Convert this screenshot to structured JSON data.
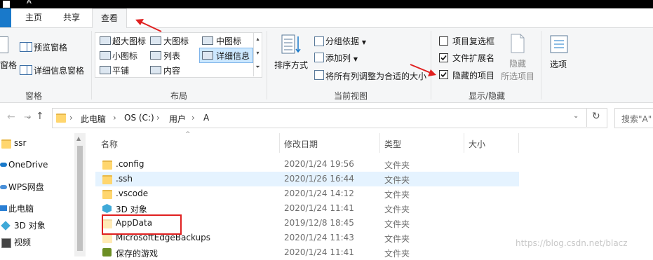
{
  "window": {
    "title": "A"
  },
  "ribbon_tabs": [
    {
      "label": "主页"
    },
    {
      "label": "共享"
    },
    {
      "label": "查看",
      "active": true
    }
  ],
  "ribbon": {
    "panes_group": {
      "nav_pane_partial": "窗格",
      "preview_pane": "预览窗格",
      "details_pane": "详细信息窗格",
      "label": "窗格"
    },
    "layout_group": {
      "options": [
        "超大图标",
        "大图标",
        "中图标",
        "小图标",
        "列表",
        "详细信息",
        "平铺",
        "内容"
      ],
      "selected": "详细信息",
      "label": "布局"
    },
    "current_view_group": {
      "sort_by": "排序方式",
      "group_by": "分组依据",
      "add_columns": "添加列",
      "size_columns": "将所有列调整为合适的大小",
      "label": "当前视图"
    },
    "show_hide_group": {
      "item_checkboxes": {
        "label": "项目复选框",
        "checked": false
      },
      "file_extensions": {
        "label": "文件扩展名",
        "checked": true
      },
      "hidden_items": {
        "label": "隐藏的项目",
        "checked": true
      },
      "hide_selected_line1": "隐藏",
      "hide_selected_line2": "所选项目",
      "label": "显示/隐藏"
    },
    "options_label": "选项"
  },
  "address_bar": {
    "path": [
      "此电脑",
      "OS (C:)",
      "用户",
      "A"
    ],
    "search_placeholder": "搜索\"A\""
  },
  "nav_pane": {
    "items": [
      {
        "label": "ssr",
        "icon": "folder-icon"
      },
      {
        "label": "OneDrive",
        "icon": "cloud-icon"
      },
      {
        "label": "WPS网盘",
        "icon": "cloud-icon"
      },
      {
        "label": "此电脑",
        "icon": "pc-icon"
      },
      {
        "label": "3D 对象",
        "icon": "cube-icon"
      },
      {
        "label": "视频",
        "icon": "video-icon"
      }
    ]
  },
  "columns": [
    "名称",
    "修改日期",
    "类型",
    "大小"
  ],
  "files": [
    {
      "name": ".config",
      "date": "2020/1/24 19:56",
      "type": "文件夹",
      "icon": "folder-icon"
    },
    {
      "name": ".ssh",
      "date": "2020/1/26 16:44",
      "type": "文件夹",
      "icon": "folder-icon",
      "selected": true
    },
    {
      "name": ".vscode",
      "date": "2020/1/24 14:12",
      "type": "文件夹",
      "icon": "folder-icon"
    },
    {
      "name": "3D 对象",
      "date": "2020/1/24 11:41",
      "type": "文件夹",
      "icon": "cube-icon"
    },
    {
      "name": "AppData",
      "date": "2019/12/8 18:45",
      "type": "文件夹",
      "icon": "hidden-folder-icon"
    },
    {
      "name": "MicrosoftEdgeBackups",
      "date": "2020/1/24 11:43",
      "type": "文件夹",
      "icon": "hidden-folder-icon"
    },
    {
      "name": "保存的游戏",
      "date": "2020/1/24 11:41",
      "type": "文件夹",
      "icon": "games-icon"
    }
  ],
  "watermark": "https://blog.csdn.net/blacz",
  "colors": {
    "annotation": "#e02020",
    "accent": "#1979ca",
    "selection": "#e5f3ff"
  }
}
